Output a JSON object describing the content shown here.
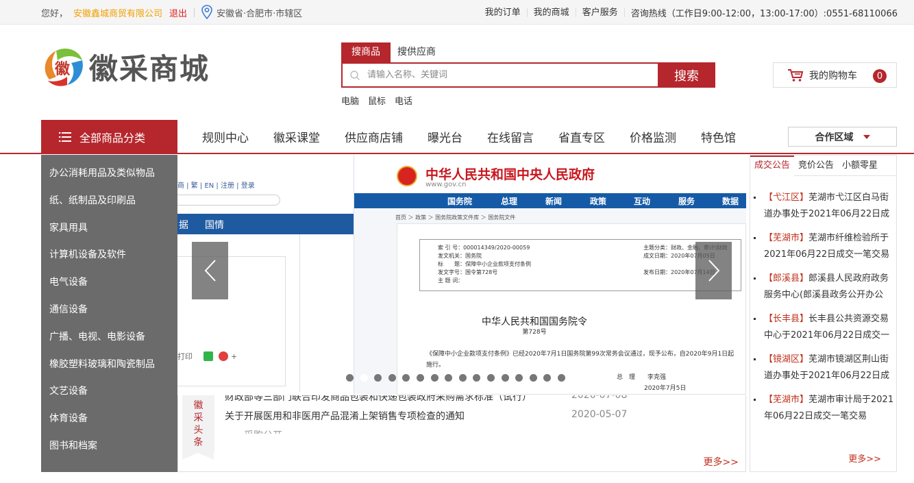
{
  "topbar": {
    "greeting": "您好，",
    "company": "安徽鑫城商贸有限公司",
    "logout": "退出",
    "location": "安徽省·合肥市·市辖区",
    "links": [
      "我的订单",
      "我的商城",
      "客户服务"
    ],
    "hotline": "咨询热线（工作日9:00-12:00，13:00-17:00）:0551-68110066"
  },
  "header": {
    "logo_text": "徽采商城",
    "logo_mark_char": "徽",
    "search_tabs": [
      "搜商品",
      "搜供应商"
    ],
    "search_placeholder": "请输入名称、关键词",
    "search_button": "搜索",
    "hotwords": [
      "电脑",
      "鼠标",
      "电话"
    ],
    "cart_label": "我的购物车",
    "cart_count": "0"
  },
  "nav": {
    "all_categories": "全部商品分类",
    "items": [
      "规则中心",
      "徽采课堂",
      "供应商店铺",
      "曝光台",
      "在线留言",
      "省直专区",
      "价格监测",
      "特色馆"
    ],
    "region": "合作区域"
  },
  "sidebar": {
    "categories": [
      "办公消耗用品及类似物品",
      "纸、纸制品及印刷品",
      "家具用具",
      "计算机设备及软件",
      "电气设备",
      "通信设备",
      "广播、电视、电影设备",
      "橡胶塑料玻璃和陶瓷制品",
      "文艺设备",
      "体育设备",
      "图书和档案"
    ]
  },
  "banner": {
    "slide1": {
      "toolbar_text": "商 | 繁 | EN | 注册 | 登录",
      "bar_items": [
        "据",
        "国情"
      ],
      "print": "打印",
      "plus": "+"
    },
    "slide2": {
      "title": "中华人民共和国中央人民政府",
      "url": "www.gov.cn",
      "nav": [
        "国务院",
        "总理",
        "新闻",
        "政策",
        "互动",
        "服务",
        "数据"
      ],
      "crumb": "首页 ＞ 政策 ＞ 国务院政策文件库 ＞ 国务院文件",
      "meta_left": [
        "索 引 号：000014349/2020-00059",
        "发文机关：国务院",
        "标　　题：保障中小企业款项支付条例",
        "发文字号：国令第728号",
        "主 题 词："
      ],
      "meta_right": [
        "主题分类：财政、金融、审计\\财政",
        "成文日期：2020年07月05日",
        "",
        "发布日期：2020年07月14日"
      ],
      "doc_title": "中华人民共和国国务院令",
      "doc_no": "第728号",
      "doc_body": "《保障中小企业款项支付条例》已经2020年7月1日国务院第99次常务会议通过，现予公布，自2020年9月1日起施行。",
      "doc_sign": "总　理　　李克强",
      "doc_date": "2020年7月5日"
    },
    "dot_count": 16,
    "active_dot": 1
  },
  "headline": {
    "tag": "徽采头条",
    "items": [
      {
        "title": "财政部等三部门联合印发商品包装和快递包装政府采购需求标准（试行）",
        "date": "2020-07-08"
      },
      {
        "title": "关于开展医用和非医用产品混淆上架销售专项检查的通知",
        "date": "2020-05-07"
      },
      {
        "title": "……采购公开……",
        "date": ""
      }
    ],
    "more": "更多>>"
  },
  "notice": {
    "tabs": [
      "成交公告",
      "竞价公告",
      "小额零星"
    ],
    "active_tab": 0,
    "items": [
      {
        "place": "【弋江区】",
        "text": "芜湖市弋江区白马街道办事处于2021年06月22日成"
      },
      {
        "place": "【芜湖市】",
        "text": "芜湖市纤维检验所于2021年06月22日成交一笔交易"
      },
      {
        "place": "【郎溪县】",
        "text": "郎溪县人民政府政务服务中心(郎溪县政务公开办公"
      },
      {
        "place": "【长丰县】",
        "text": "长丰县公共资源交易中心于2021年06月22日成交一"
      },
      {
        "place": "【镜湖区】",
        "text": "芜湖市镜湖区荆山街道办事处于2021年06月22日成"
      },
      {
        "place": "【芜湖市】",
        "text": "芜湖市审计局于2021年06月22日成交一笔交易"
      }
    ],
    "more": "更多>>"
  },
  "colors": {
    "brand": "#b5272d",
    "company": "#f0a000",
    "sidebar": "#6b6b6b",
    "gov_blue": "#155aa6"
  }
}
